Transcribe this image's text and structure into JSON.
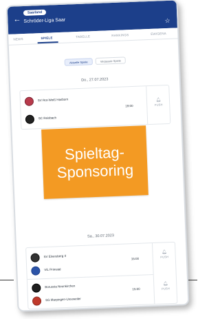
{
  "colors": {
    "header_bg": "#1c3f8a",
    "promo_bg": "#f39a23",
    "active_tab": "#1c3f8a",
    "text_primary": "#27303a",
    "text_muted": "#8c96a3"
  },
  "header": {
    "back_icon": "arrow-left-icon",
    "badge": "Saarland",
    "title": "Schröder-Liga Saar",
    "star_icon": "star-icon"
  },
  "tabs": [
    {
      "label": "NEWS",
      "active": false
    },
    {
      "label": "SPIELE",
      "active": true
    },
    {
      "label": "TABELLE",
      "active": false
    },
    {
      "label": "RANKINGS",
      "active": false
    },
    {
      "label": "EWIGENA",
      "active": false
    }
  ],
  "filters": {
    "current": "Aktuelle Spiele",
    "missed": "Verpasste Spiele"
  },
  "days": [
    {
      "date": "Do., 27.07.2023",
      "matches": [
        {
          "home": "SV Rot-Weiß Hasborn",
          "away": "SC Reisbach",
          "time": "19:00",
          "push": "PUSH"
        }
      ]
    },
    {
      "date": "Sa., 30.07.2023",
      "matches": [
        {
          "home": "SV Elversberg II",
          "away": "VfL Primstal",
          "time": "15:00",
          "push": "PUSH"
        },
        {
          "home": "Borussia Neunkirchen",
          "away": "SG Marpingen-Urexweiler",
          "time": "15:00",
          "push": "PUSH"
        }
      ]
    }
  ],
  "promo": {
    "line1": "Spieltag-",
    "line2": "Sponsoring"
  }
}
